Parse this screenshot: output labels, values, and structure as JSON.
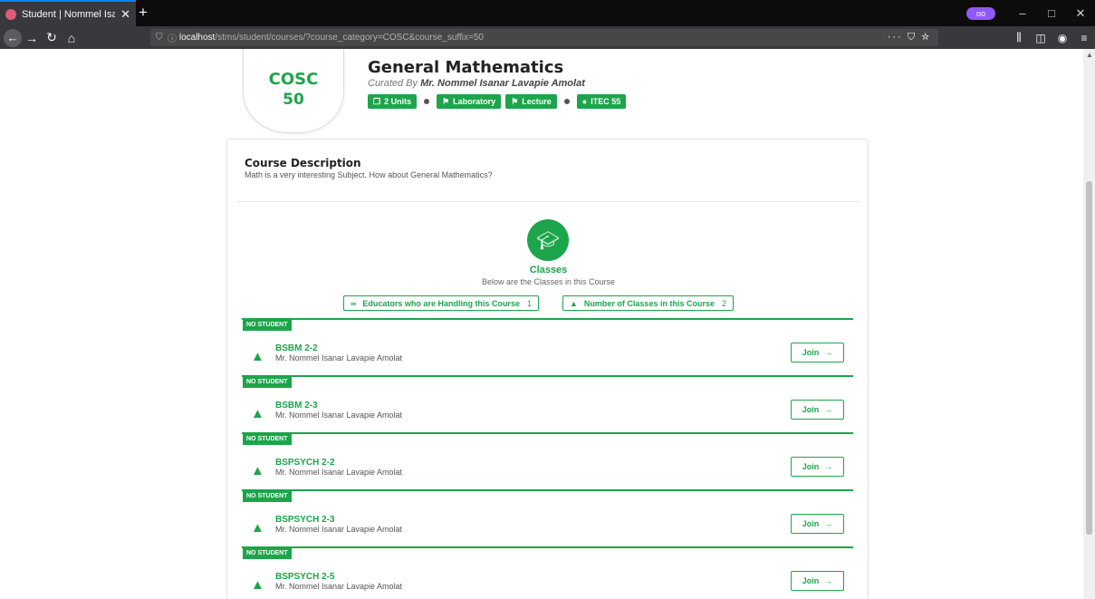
{
  "browser": {
    "tab_title": "Student | Nommel Isanar Lavap",
    "tab_close": "✕",
    "new_tab": "+",
    "url_prefix": "localhost",
    "url_rest": "/stms/student/courses/?course_category=COSC&course_suffix=50",
    "url_actions": "··· ⛉ ☆",
    "window_controls": [
      "–",
      "□",
      "✕"
    ],
    "nav_right_icons": [
      "library-icon",
      "sidebar-icon",
      "account-icon",
      "menu-icon"
    ]
  },
  "course": {
    "category": "COSC",
    "suffix": "50",
    "title": "General Mathematics",
    "curated_prefix": "Curated By",
    "curator": "Mr. Nommel Isanar Lavapie Amolat",
    "badges": {
      "units": "2 Units",
      "laboratory": "Laboratory",
      "lecture": "Lecture",
      "prerequisite": "ITEC 55"
    }
  },
  "description": {
    "title": "Course Description",
    "text": "Math is a very interesting Subject. How about General Mathematics?"
  },
  "classes": {
    "title": "Classes",
    "subtitle": "Below are the Classes in this Course",
    "educators_label": "Educators who are Handling this Course",
    "educators_count": "1",
    "classes_label": "Number of Classes in this Course",
    "classes_count": "2",
    "join_label": "Join",
    "items": [
      {
        "status": "NO STUDENT",
        "name": "BSBM 2-2",
        "teacher": "Mr. Nommel Isanar Lavapie Amolat"
      },
      {
        "status": "NO STUDENT",
        "name": "BSBM 2-3",
        "teacher": "Mr. Nommel Isanar Lavapie Amolat"
      },
      {
        "status": "NO STUDENT",
        "name": "BSPSYCH 2-2",
        "teacher": "Mr. Nommel Isanar Lavapie Amolat"
      },
      {
        "status": "NO STUDENT",
        "name": "BSPSYCH 2-3",
        "teacher": "Mr. Nommel Isanar Lavapie Amolat"
      },
      {
        "status": "NO STUDENT",
        "name": "BSPSYCH 2-5",
        "teacher": "Mr. Nommel Isanar Lavapie Amolat"
      }
    ]
  },
  "colors": {
    "accent": "#1ca54a"
  }
}
